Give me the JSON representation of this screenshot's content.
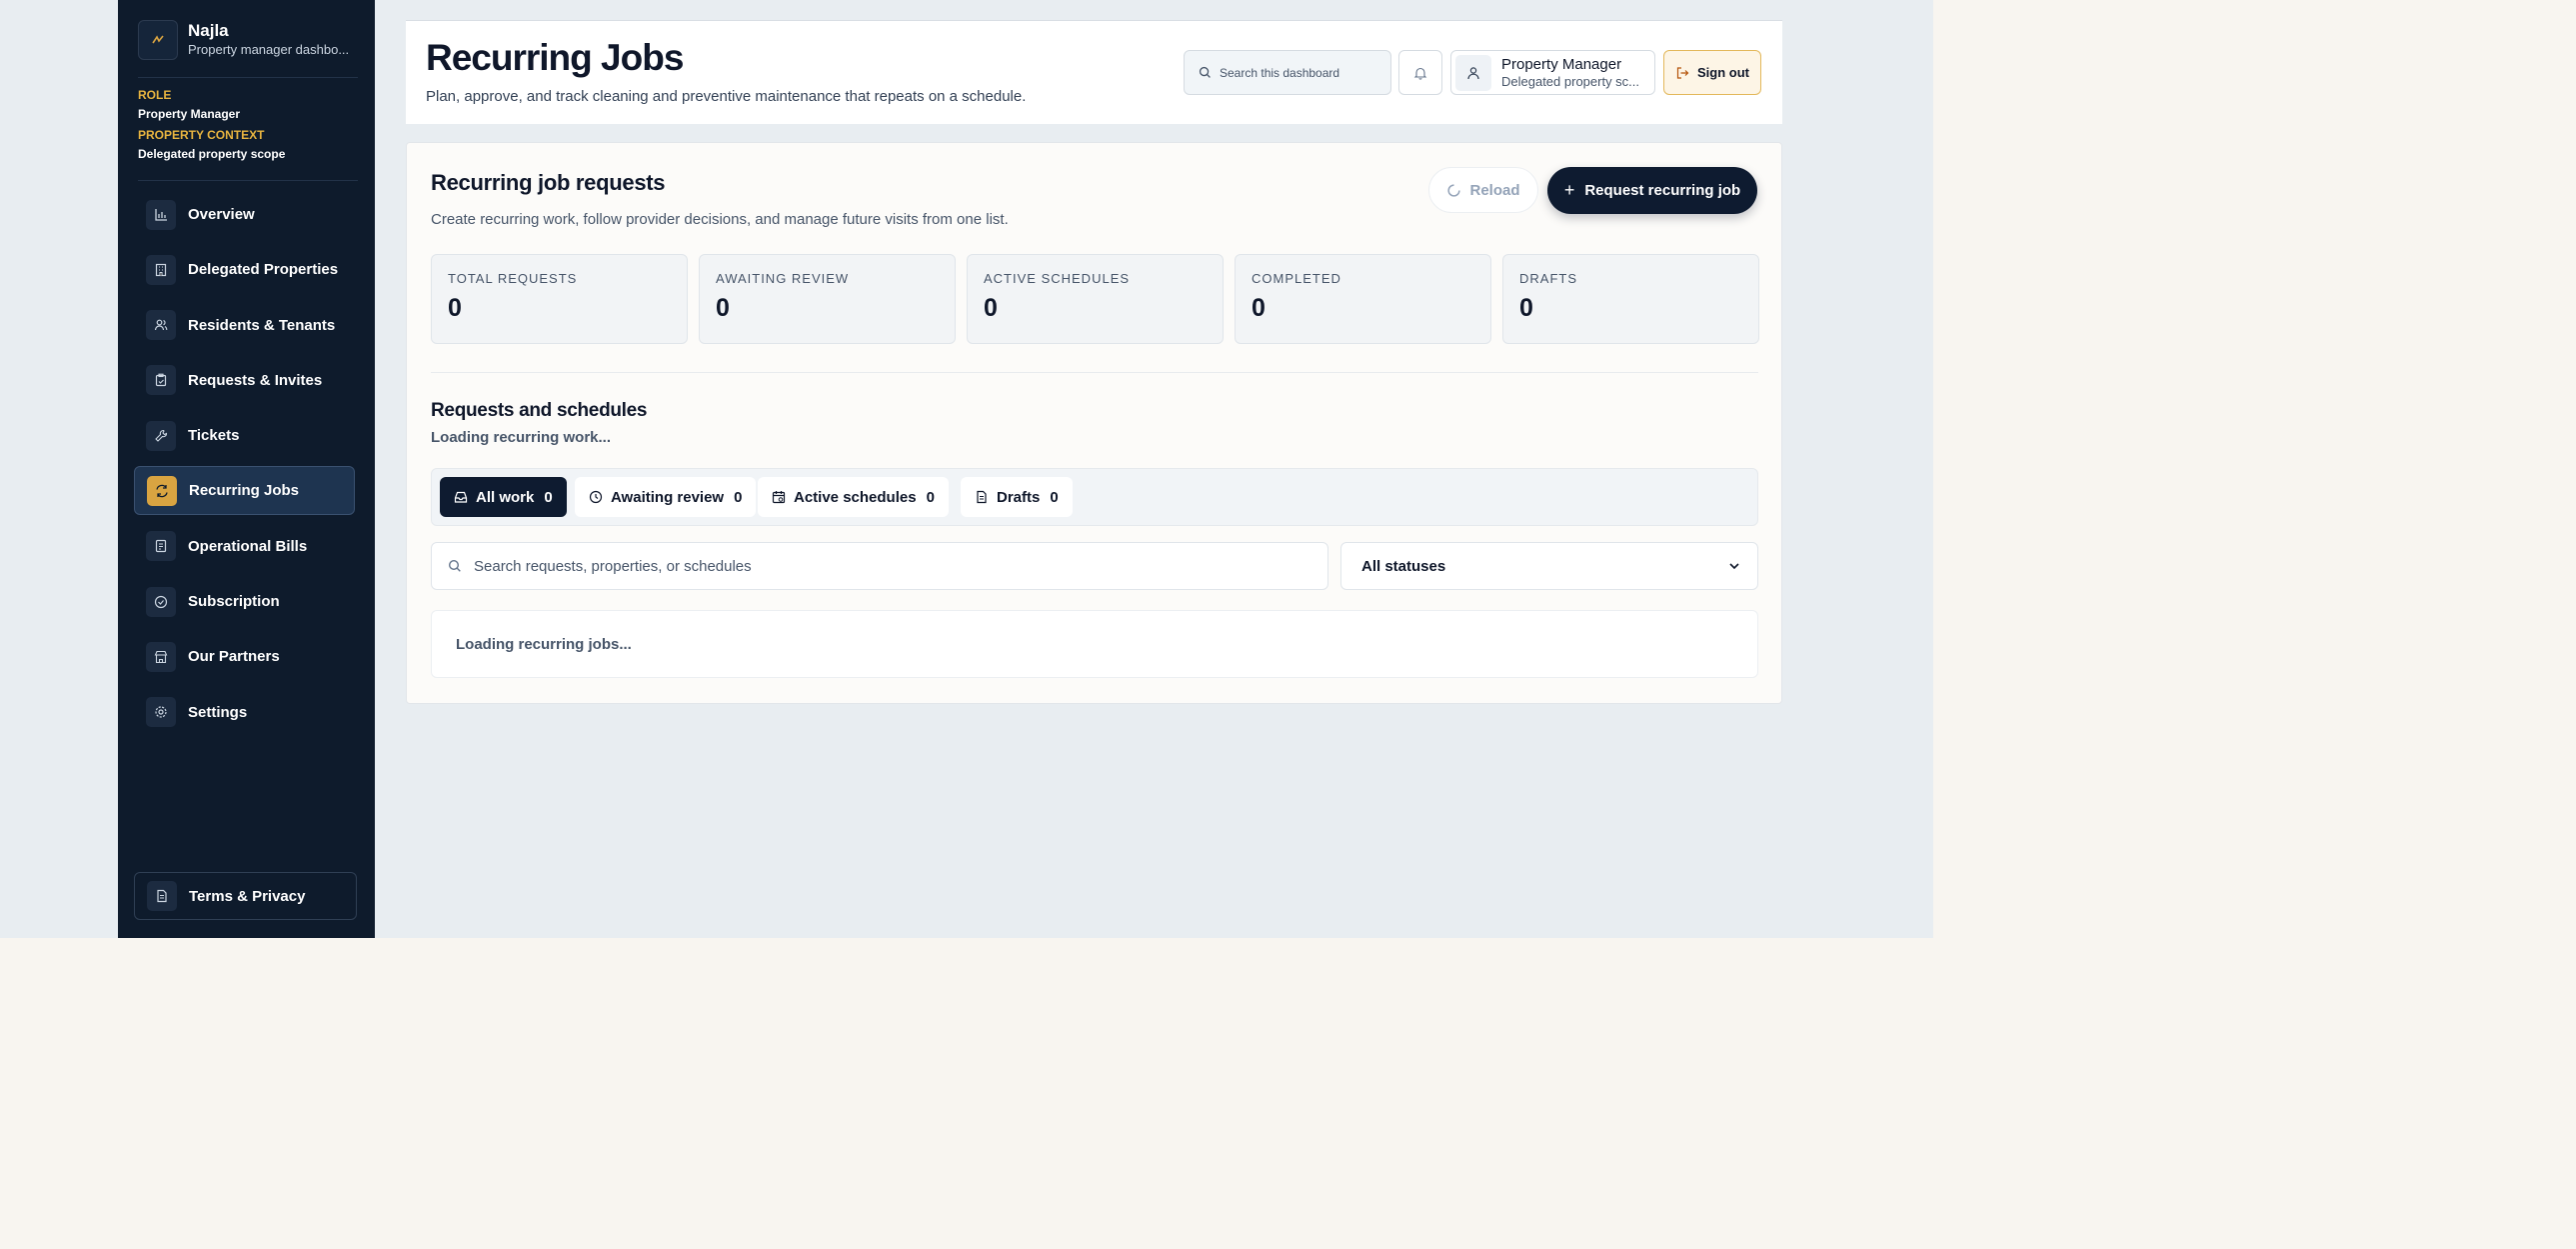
{
  "sidebar": {
    "brand_name": "Najla",
    "brand_sub": "Property manager dashbo...",
    "role_label": "ROLE",
    "role_value": "Property Manager",
    "context_label": "PROPERTY CONTEXT",
    "context_value": "Delegated property scope",
    "items": [
      {
        "label": "Overview",
        "icon": "chart-icon"
      },
      {
        "label": "Delegated Properties",
        "icon": "building-icon"
      },
      {
        "label": "Residents & Tenants",
        "icon": "users-icon"
      },
      {
        "label": "Requests & Invites",
        "icon": "clipboard-icon"
      },
      {
        "label": "Tickets",
        "icon": "wrench-icon"
      },
      {
        "label": "Recurring Jobs",
        "icon": "refresh-icon",
        "active": true
      },
      {
        "label": "Operational Bills",
        "icon": "receipt-icon"
      },
      {
        "label": "Subscription",
        "icon": "check-circle-icon"
      },
      {
        "label": "Our Partners",
        "icon": "store-icon"
      },
      {
        "label": "Settings",
        "icon": "gear-icon"
      }
    ],
    "terms_label": "Terms & Privacy"
  },
  "header": {
    "title": "Recurring Jobs",
    "subtitle": "Plan, approve, and track cleaning and preventive maintenance that repeats on a schedule.",
    "search_placeholder": "Search this dashboard",
    "user_name": "Property Manager",
    "user_scope": "Delegated property sc...",
    "signout_label": "Sign out"
  },
  "main": {
    "title": "Recurring job requests",
    "subtitle": "Create recurring work, follow provider decisions, and manage future visits from one list.",
    "reload_label": "Reload",
    "request_label": "Request recurring job",
    "stats": [
      {
        "label": "TOTAL REQUESTS",
        "value": "0"
      },
      {
        "label": "AWAITING REVIEW",
        "value": "0"
      },
      {
        "label": "ACTIVE SCHEDULES",
        "value": "0"
      },
      {
        "label": "COMPLETED",
        "value": "0"
      },
      {
        "label": "DRAFTS",
        "value": "0"
      }
    ],
    "section_title": "Requests and schedules",
    "section_status": "Loading recurring work...",
    "tabs": [
      {
        "label": "All work",
        "count": "0",
        "active": true
      },
      {
        "label": "Awaiting review",
        "count": "0"
      },
      {
        "label": "Active schedules",
        "count": "0"
      },
      {
        "label": "Drafts",
        "count": "0"
      }
    ],
    "filter_placeholder": "Search requests, properties, or schedules",
    "status_select": "All statuses",
    "loading_text": "Loading recurring jobs..."
  },
  "colors": {
    "sidebar_bg": "#0e1b2c",
    "accent_gold": "#d9a441",
    "primary_navy": "#0e1b30",
    "page_bg": "#e8edf1"
  }
}
